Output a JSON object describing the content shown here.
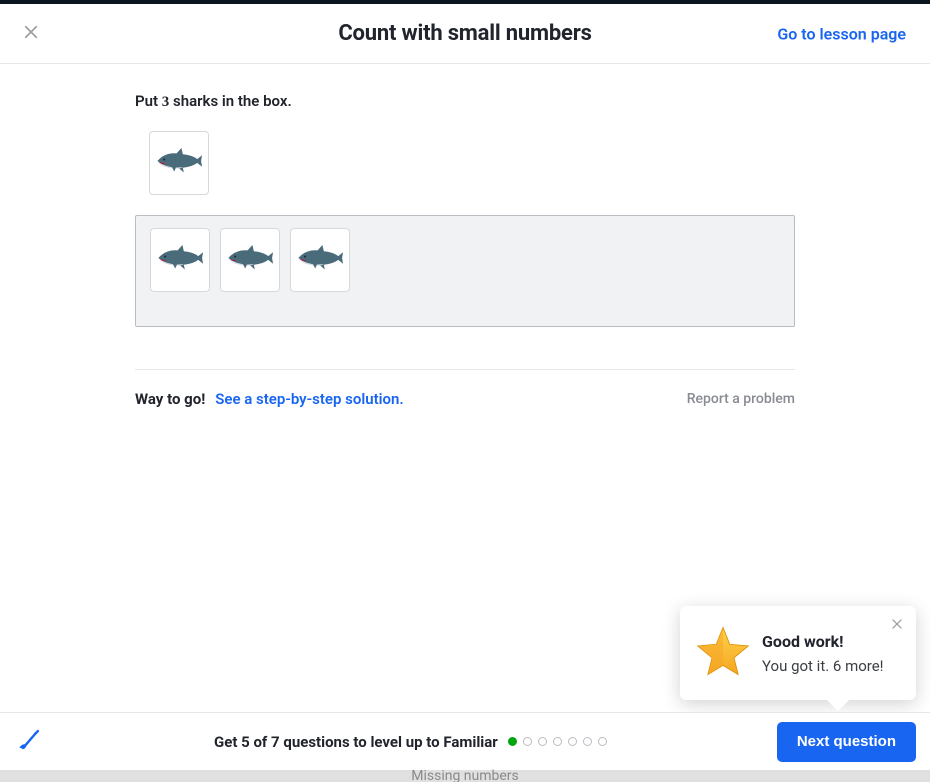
{
  "header": {
    "title": "Count with small numbers",
    "lesson_link": "Go to lesson page"
  },
  "exercise": {
    "prompt_prefix": "Put ",
    "prompt_number": "3",
    "prompt_suffix": " sharks in the box.",
    "source_count": 1,
    "target_count": 3,
    "item_icon": "shark-icon"
  },
  "feedback": {
    "way_to_go": "Way to go!",
    "solution_link": "See a step-by-step solution.",
    "report": "Report a problem"
  },
  "popover": {
    "title": "Good work!",
    "subtitle": "You got it. 6 more!"
  },
  "footer": {
    "level_text": "Get 5 of 7 questions to level up to Familiar",
    "progress_total": 7,
    "progress_done": 1,
    "next_button": "Next question"
  },
  "background_hint": "Missing numbers"
}
